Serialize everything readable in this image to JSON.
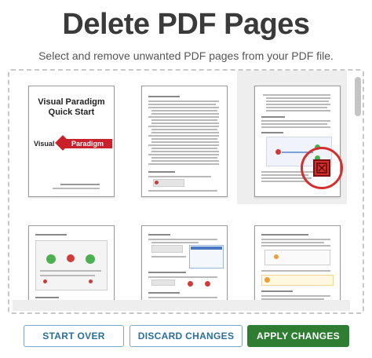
{
  "header": {
    "title": "Delete PDF Pages",
    "subtitle": "Select and remove unwanted PDF pages from your PDF file."
  },
  "pages": [
    {
      "cover_title_line1": "Visual Paradigm",
      "cover_title_line2": "Quick Start",
      "logo_left": "Visual",
      "logo_right": "Paradigm"
    }
  ],
  "actions": {
    "start_over": "START OVER",
    "discard_changes": "DISCARD CHANGES",
    "apply_changes": "APPLY CHANGES"
  },
  "colors": {
    "brand_red": "#c9202b",
    "delete_red": "#d32f2f",
    "apply_green": "#2e7d32",
    "outline_blue": "#2b6f9b"
  },
  "icons": {
    "delete": "delete-page-icon"
  }
}
